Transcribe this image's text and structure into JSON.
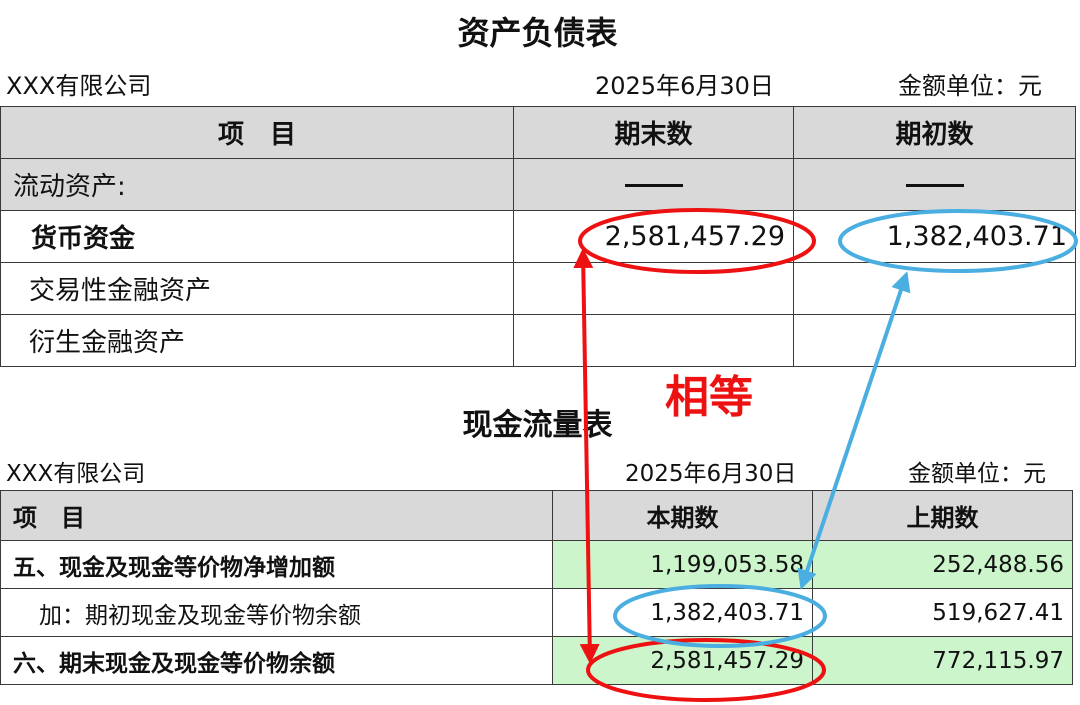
{
  "balance_sheet": {
    "title": "资产负债表",
    "company": "XXX有限公司",
    "date": "2025年6月30日",
    "unit": "金额单位：元",
    "headers": [
      "项　目",
      "期末数",
      "期初数"
    ],
    "rows": [
      {
        "item": "流动资产:",
        "end": "——",
        "begin": "——"
      },
      {
        "item": "货币资金",
        "end": "2,581,457.29",
        "begin": "1,382,403.71"
      },
      {
        "item": "交易性金融资产",
        "end": "",
        "begin": ""
      },
      {
        "item": "衍生金融资产",
        "end": "",
        "begin": ""
      }
    ]
  },
  "annotation": {
    "equal_label": "相等",
    "red_color": "#ee1111",
    "blue_color": "#4aaee0"
  },
  "cash_flow": {
    "title": "现金流量表",
    "company": "XXX有限公司",
    "date": "2025年6月30日",
    "unit": "金额单位：元",
    "headers": [
      "项　目",
      "本期数",
      "上期数"
    ],
    "rows": [
      {
        "item": "五、现金及现金等价物净增加额",
        "current": "1,199,053.58",
        "previous": "252,488.56"
      },
      {
        "item": "加：期初现金及现金等价物余额",
        "current": "1,382,403.71",
        "previous": "519,627.41"
      },
      {
        "item": "六、期末现金及现金等价物余额",
        "current": "2,581,457.29",
        "previous": "772,115.97"
      }
    ]
  }
}
